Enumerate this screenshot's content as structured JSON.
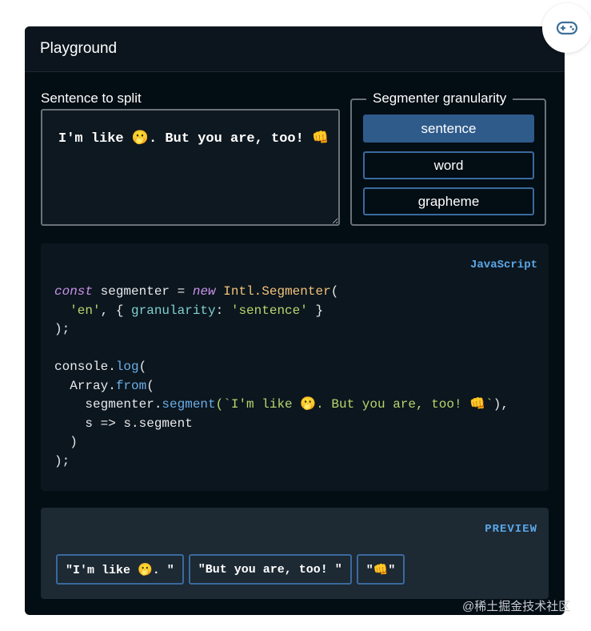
{
  "header": {
    "title": "Playground"
  },
  "input": {
    "label": "Sentence to split",
    "value": "I'm like 🫢. But you are, too! 👊"
  },
  "granularity": {
    "legend": "Segmenter granularity",
    "options": [
      "sentence",
      "word",
      "grapheme"
    ],
    "selected": "sentence"
  },
  "code": {
    "language": "JavaScript",
    "tokens": {
      "const": "const",
      "segmenter": " segmenter = ",
      "new": "new",
      "intl": "Intl.Segmenter",
      "open1": "(",
      "en": "'en'",
      "comma": ", { ",
      "granularity_key": "granularity",
      "colon": ": ",
      "granularity_val": "'sentence'",
      "close_obj": " }",
      "close1": ");",
      "console": "console.",
      "log": "log",
      "open2": "(",
      "array": "Array.",
      "from": "from",
      "open3": "(",
      "seg_obj": "segmenter.",
      "segment": "segment",
      "tpl": "(`I'm like 🫢. But you are, too! 👊`",
      "tpl_close": "),",
      "arrow": "s => s.segment",
      "close3": ")",
      "close2": ");"
    }
  },
  "preview": {
    "label": "PREVIEW",
    "segments": [
      "\"I'm like 🫢. \"",
      "\"But you are, too! \"",
      "\"👊\""
    ]
  },
  "watermark": "@稀土掘金技术社区",
  "colors": {
    "panel_bg": "#030d14",
    "accent_blue": "#2f5b8b",
    "tag_blue": "#5aa7e8",
    "fab_icon_bg": "#3e6f9b"
  },
  "icons": {
    "fab": "gamepad-icon"
  }
}
